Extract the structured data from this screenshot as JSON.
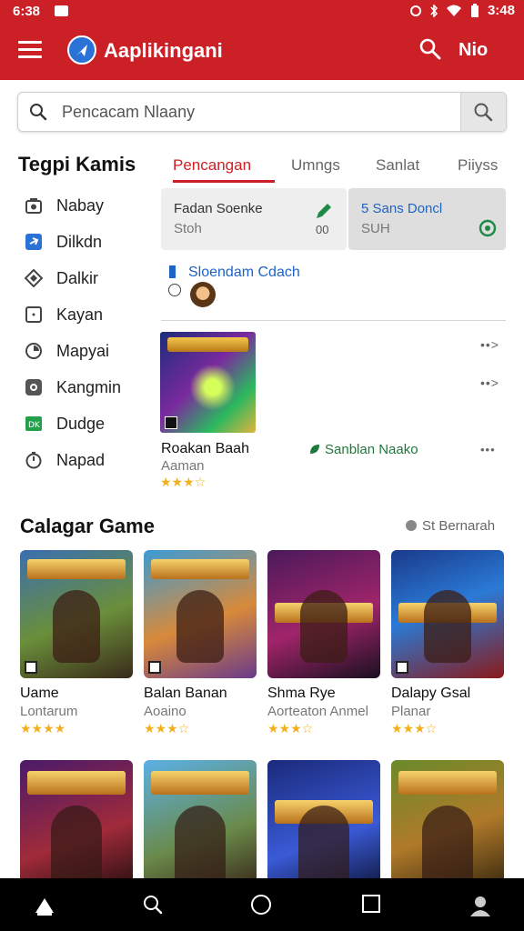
{
  "status_bar": {
    "time_left": "6:38",
    "time_right": "3:48"
  },
  "app_bar": {
    "title": "Aaplikingani",
    "user_label": "Nio"
  },
  "search": {
    "placeholder": "Pencacam Nlaany"
  },
  "categories": {
    "title": "Tegpi Kamis",
    "items": [
      {
        "label": "Nabay",
        "icon": "camera-icon"
      },
      {
        "label": "Dilkdn",
        "icon": "link-icon"
      },
      {
        "label": "Dalkir",
        "icon": "diamond-icon"
      },
      {
        "label": "Kayan",
        "icon": "square-icon"
      },
      {
        "label": "Mapyai",
        "icon": "circle-icon"
      },
      {
        "label": "Kangmin",
        "icon": "gamepad-icon"
      },
      {
        "label": "Dudge",
        "icon": "tag-icon"
      },
      {
        "label": "Napad",
        "icon": "timer-icon"
      }
    ]
  },
  "tabs": [
    {
      "label": "Pencangan",
      "active": true
    },
    {
      "label": "Umngs",
      "active": false
    },
    {
      "label": "Sanlat",
      "active": false
    },
    {
      "label": "Piiyss",
      "active": false
    }
  ],
  "featured_cards": [
    {
      "title": "Fadan Soenke",
      "subtitle": "Stoh",
      "number": "00"
    },
    {
      "title": "5 Sans Doncl",
      "subtitle": "SUH"
    }
  ],
  "promo": {
    "text": "Sloendam Cdach"
  },
  "featured_game": {
    "banner": "ROCKMENS",
    "name": "Roakan Baah",
    "developer": "Aaman",
    "rating": "★★★☆",
    "side_label": "Sanblan Naako",
    "more": "•••",
    "arrow_1": "••>",
    "arrow_2": "••>"
  },
  "section": {
    "title": "Calagar Game",
    "link": "St Bernarah"
  },
  "games": [
    {
      "banner": "GARDEONVIS",
      "name": "Uame",
      "developer": "Lontarum",
      "rating": "★★★★",
      "badge": "T"
    },
    {
      "banner": "CHARGEFALL",
      "name": "Balan Banan",
      "developer": "Aoaino",
      "rating": "★★★☆",
      "badge": "P"
    },
    {
      "banner": "SLORRAVAN",
      "name": "Shma Rye",
      "developer": "Aorteaton Anmel",
      "rating": "★★★☆",
      "badge": ""
    },
    {
      "banner": "DENGRIS",
      "name": "Dalapy Gsal",
      "developer": "Planar",
      "rating": "★★★☆",
      "badge": "P"
    }
  ],
  "games_row2": [
    {
      "banner": "BOADEURAIS"
    },
    {
      "banner": "SPANNIC PLOIAN"
    },
    {
      "banner": "SOTIANGIIS"
    },
    {
      "banner": "SENNALISM"
    }
  ],
  "colors": {
    "brand": "#cc2027",
    "link": "#1e63c6",
    "star": "#f2b01e"
  }
}
